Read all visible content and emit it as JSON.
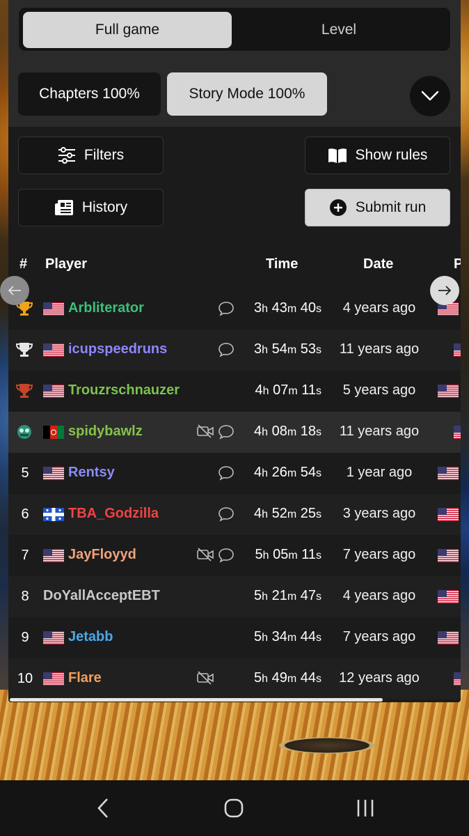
{
  "tabs": {
    "full_game": "Full game",
    "level": "Level"
  },
  "categories": {
    "chapters": "Chapters 100%",
    "story_mode": "Story Mode 100%"
  },
  "actions": {
    "filters": "Filters",
    "show_rules": "Show rules",
    "history": "History",
    "submit_run": "Submit run"
  },
  "table": {
    "headers": {
      "rank": "#",
      "player": "Player",
      "time": "Time",
      "date": "Date",
      "platform": "P"
    },
    "rows": [
      {
        "rank": "",
        "medal": "gold-trophy-icon",
        "flag": "us",
        "player": "Arbliterator",
        "color": "#3cbf7a",
        "video": false,
        "comment": true,
        "h": "3",
        "m": "43",
        "s": "40",
        "date": "4 years ago"
      },
      {
        "rank": "",
        "medal": "silver-trophy-icon",
        "flag": "us",
        "player": "icupspeedruns",
        "color": "#8c86ff",
        "video": false,
        "comment": true,
        "h": "3",
        "m": "54",
        "s": "53",
        "date": "11 years ago"
      },
      {
        "rank": "",
        "medal": "bronze-trophy-icon",
        "flag": "us",
        "player": "Trouzrschnauzer",
        "color": "#7dc24f",
        "video": false,
        "comment": false,
        "h": "4",
        "m": "07",
        "s": "11",
        "date": "5 years ago"
      },
      {
        "rank": "",
        "medal": "custom-rank-icon",
        "flag": "af",
        "player": "spidybawlz",
        "color": "#86c24a",
        "video": true,
        "comment": true,
        "h": "4",
        "m": "08",
        "s": "18",
        "date": "11 years ago"
      },
      {
        "rank": "5",
        "flag": "us",
        "player": "Rentsy",
        "color": "#8a8cf5",
        "video": false,
        "comment": true,
        "h": "4",
        "m": "26",
        "s": "54",
        "date": "1 year ago"
      },
      {
        "rank": "6",
        "flag": "qc",
        "player": "TBA_Godzilla",
        "color": "#ef4444",
        "video": false,
        "comment": true,
        "h": "4",
        "m": "52",
        "s": "25",
        "date": "3 years ago"
      },
      {
        "rank": "7",
        "flag": "us",
        "player": "JayFloyyd",
        "color": "#f2a27a",
        "video": true,
        "comment": true,
        "h": "5",
        "m": "05",
        "s": "11",
        "date": "7 years ago"
      },
      {
        "rank": "8",
        "flag": "",
        "player": "DoYallAcceptEBT",
        "color": "#c9c9c9",
        "video": false,
        "comment": false,
        "h": "5",
        "m": "21",
        "s": "47",
        "date": "4 years ago"
      },
      {
        "rank": "9",
        "flag": "us",
        "player": "Jetabb",
        "color": "#4aa8e8",
        "video": false,
        "comment": false,
        "h": "5",
        "m": "34",
        "s": "44",
        "date": "7 years ago"
      },
      {
        "rank": "10",
        "flag": "us",
        "player": "Flare",
        "color": "#f59e5b",
        "video": true,
        "comment": false,
        "h": "5",
        "m": "49",
        "s": "44",
        "date": "12 years ago"
      }
    ]
  },
  "time_units": {
    "h": "h",
    "m": "m",
    "s": "s"
  }
}
